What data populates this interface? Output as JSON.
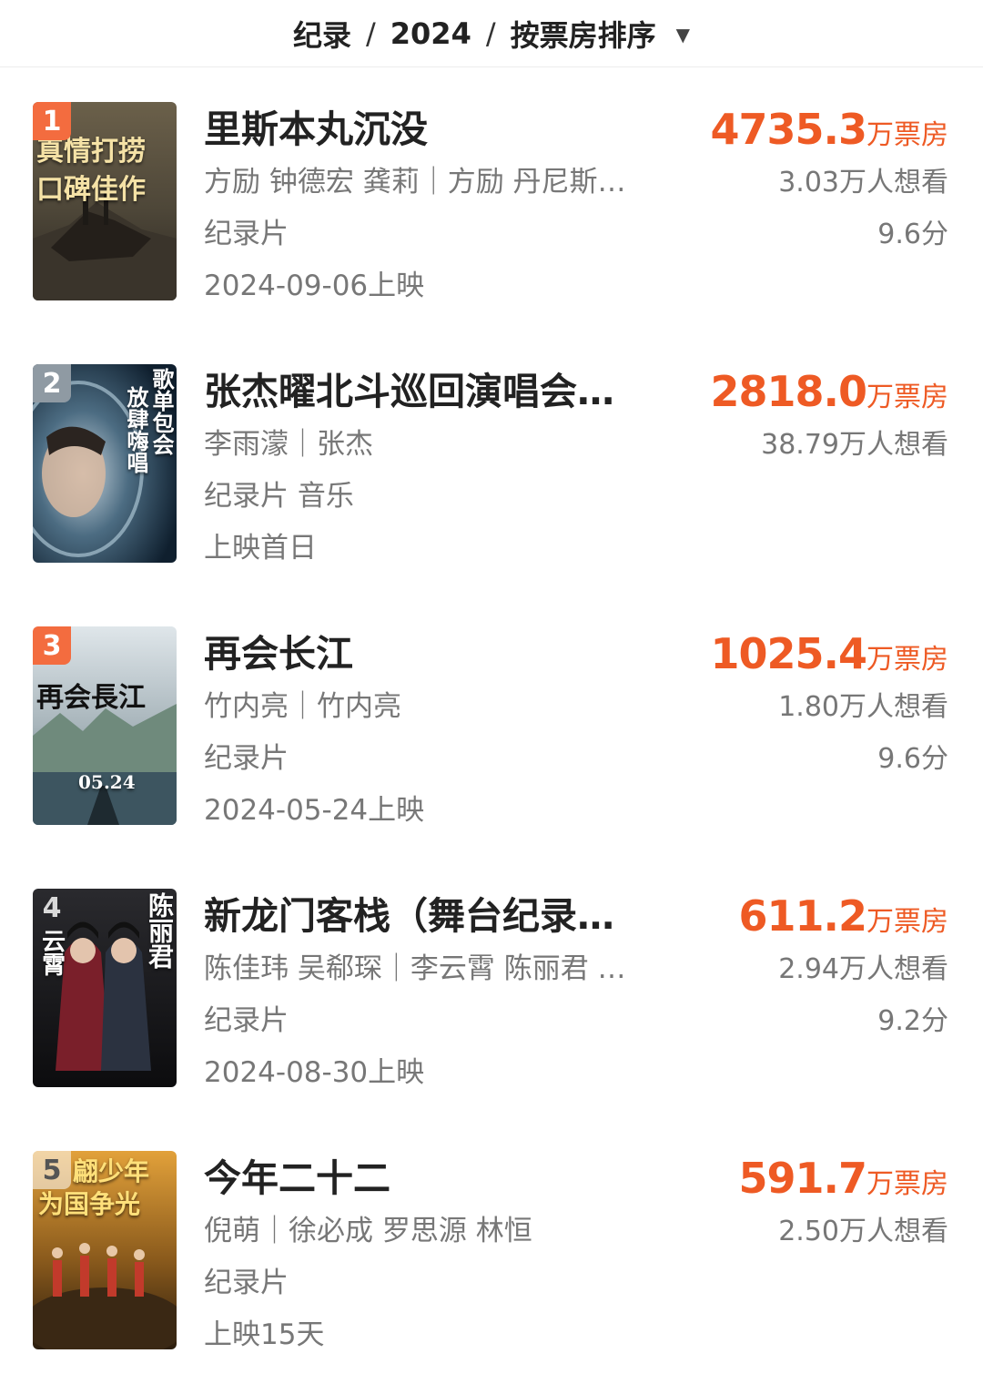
{
  "header": {
    "category": "纪录",
    "separator": "/",
    "year": "2024",
    "sort": "按票房排序",
    "caret_icon": "caret-down-icon"
  },
  "colors": {
    "accent": "#ee5a24",
    "rank_top": "#f36c3f",
    "rank_other": "#9aa0a6"
  },
  "movies": [
    {
      "rank": "1",
      "title": "里斯本丸沉没",
      "cast": "方励 钟德宏 龚莉｜方励 丹尼斯…",
      "genre": "纪录片",
      "release": "2024-09-06上映",
      "gross": "4735.3",
      "gross_unit": "万票房",
      "want": "3.03万人想看",
      "score": "9.6分",
      "poster_text": [
        "真情打捞",
        "口碑佳作"
      ]
    },
    {
      "rank": "2",
      "title": "张杰曜北斗巡回演唱会…",
      "cast": "李雨濛｜张杰",
      "genre": "纪录片 音乐",
      "release": "上映首日",
      "gross": "2818.0",
      "gross_unit": "万票房",
      "want": "38.79万人想看",
      "score": "",
      "poster_text": [
        "歌单包会",
        "放肆嗨唱"
      ]
    },
    {
      "rank": "3",
      "title": "再会长江",
      "cast": "竹内亮｜竹内亮",
      "genre": "纪录片",
      "release": "2024-05-24上映",
      "gross": "1025.4",
      "gross_unit": "万票房",
      "want": "1.80万人想看",
      "score": "9.6分",
      "poster_text": [
        "再会長江",
        "05.24"
      ]
    },
    {
      "rank": "4",
      "title": "新龙门客栈（舞台纪录…",
      "cast": "陈佳玮 吴郗琛｜李云霄 陈丽君 …",
      "genre": "纪录片",
      "release": "2024-08-30上映",
      "gross": "611.2",
      "gross_unit": "万票房",
      "want": "2.94万人想看",
      "score": "9.2分",
      "poster_text": [
        "陈丽君",
        "云霄"
      ]
    },
    {
      "rank": "5",
      "title": "今年二十二",
      "cast": "倪萌｜徐必成 罗思源 林恒",
      "genre": "纪录片",
      "release": "上映15天",
      "gross": "591.7",
      "gross_unit": "万票房",
      "want": "2.50万人想看",
      "score": "",
      "poster_text": [
        "翩少年",
        "为国争光"
      ]
    }
  ]
}
